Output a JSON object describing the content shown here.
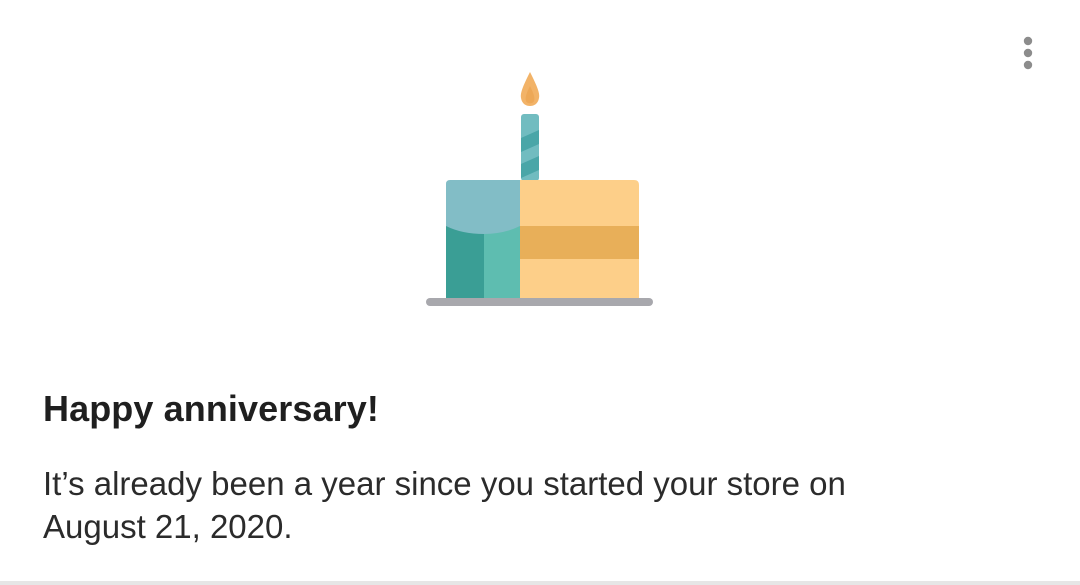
{
  "card": {
    "title": "Happy anniversary!",
    "body_line1": "It’s already been a year since you started your store on",
    "body_line2": "August 21, 2020."
  },
  "menu": {
    "icon": "more-vert-icon"
  },
  "illustration": {
    "icon": "birthday-cake-icon",
    "colors": {
      "flame": "#f2b368",
      "candle": "#71bcc0",
      "teal_top": "#82bdc6",
      "teal_dark": "#3a9e95",
      "teal_light": "#5ebdb0",
      "cake_light": "#fdcf89",
      "cake_band": "#e8af59",
      "plate": "#a8a8ad"
    }
  }
}
